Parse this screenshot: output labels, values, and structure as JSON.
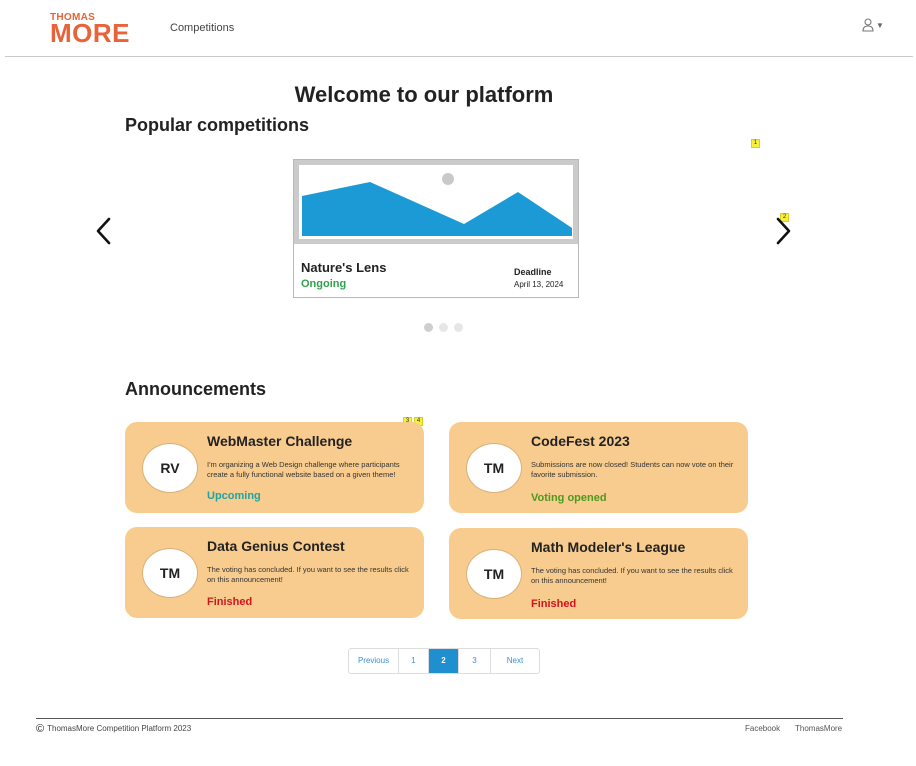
{
  "brand": {
    "logo_top": "THOMAS",
    "logo_bottom": "MORE",
    "color": "#e8623a"
  },
  "nav": {
    "competitions_label": "Competitions",
    "user_icon": "user-icon"
  },
  "page": {
    "welcome": "Welcome to our platform",
    "popular_title": "Popular competitions",
    "announcements_title": "Announcements"
  },
  "markers": [
    "1",
    "2",
    "3",
    "4"
  ],
  "carousel": {
    "active_index": 0,
    "slide_count": 3,
    "card": {
      "name": "Nature's Lens",
      "status": "Ongoing",
      "status_color": "#2fa24a",
      "deadline_label": "Deadline",
      "deadline": "April 13, 2024",
      "image_icon": "landscape-placeholder-icon"
    }
  },
  "announcements": [
    {
      "initials": "RV",
      "name": "WebMaster Challenge",
      "desc": "I'm organizing a Web Design challenge where participants create a fully functional website based on a given theme!",
      "status": "Upcoming",
      "status_color": "#1fa3a3"
    },
    {
      "initials": "TM",
      "name": "CodeFest 2023",
      "desc": "Submissions are now closed! Students can now vote on their favorite submission.",
      "status": "Voting opened",
      "status_color": "#4c9a1e"
    },
    {
      "initials": "TM",
      "name": "Data Genius Contest",
      "desc": "The voting has concluded. If you want to see the results click on this announcement!",
      "status": "Finished",
      "status_color": "#d3141c"
    },
    {
      "initials": "TM",
      "name": "Math Modeler's League",
      "desc": "The voting has concluded. If you want to see the results click on this announcement!",
      "status": "Finished",
      "status_color": "#d3141c"
    }
  ],
  "card_color": "#f8cc8e",
  "pagination": {
    "previous": "Previous",
    "pages": [
      "1",
      "2",
      "3"
    ],
    "active": "2",
    "next": "Next",
    "accent": "#1f8fd0"
  },
  "footer": {
    "copyright": "ThomasMore Competition Platform 2023",
    "links": [
      "Facebook",
      "ThomasMore"
    ]
  }
}
